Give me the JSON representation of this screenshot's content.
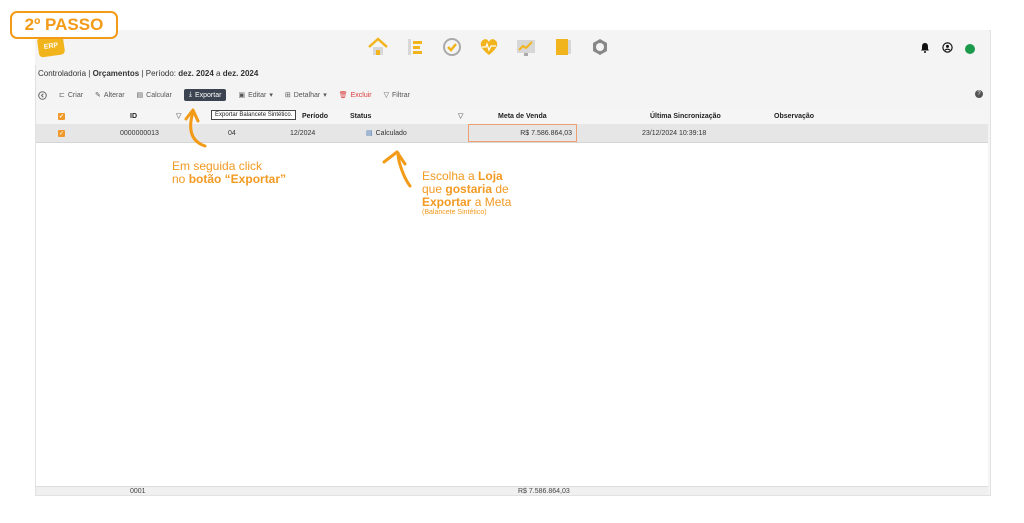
{
  "step_badge": "2º PASSO",
  "logo_text": "ERP",
  "nav_icons": [
    "home-icon",
    "list-icon",
    "check-icon",
    "heart-icon",
    "chart-icon",
    "book-icon",
    "settings-icon"
  ],
  "breadcrumb": {
    "module": "Controladoria",
    "sep1": " | ",
    "page": "Orçamentos",
    "sep2": " | Período: ",
    "from": "dez. 2024",
    "to_word": " a ",
    "to": "dez. 2024"
  },
  "toolbar": {
    "criar": "Criar",
    "alterar": "Alterar",
    "calcular": "Calcular",
    "exportar": "Exportar",
    "editar": "Editar",
    "detalhar": "Detalhar",
    "excluir": "Excluir",
    "filtrar": "Filtrar"
  },
  "tooltip": "Exportar Balancete Sintético.",
  "columns": {
    "id": "ID",
    "periodo": "Período",
    "status": "Status",
    "meta": "Meta de Venda",
    "sync": "Última Sincronização",
    "obs": "Observação"
  },
  "row": {
    "id": "0000000013",
    "loja": "04",
    "periodo": "12/2024",
    "status": "Calculado",
    "meta": "R$ 7.586.864,03",
    "sync": "23/12/2024 10:39:18",
    "obs": ""
  },
  "footer": {
    "count": "0001",
    "total": "R$ 7.586.864,03"
  },
  "annotation1": {
    "line1": "Em seguida click",
    "line2a": "no ",
    "line2b": "botão “Exportar”"
  },
  "annotation2": {
    "l1a": "Escolha a ",
    "l1b": "Loja",
    "l2a": "que ",
    "l2b": "gostaria",
    "l2c": " de",
    "l3a": "Exportar",
    "l3b": " a Meta",
    "l4": "(Balancete Sintético)"
  },
  "colors": {
    "accent": "#f39a17",
    "status_online": "#1a9a4a",
    "danger": "#d93b3b"
  }
}
